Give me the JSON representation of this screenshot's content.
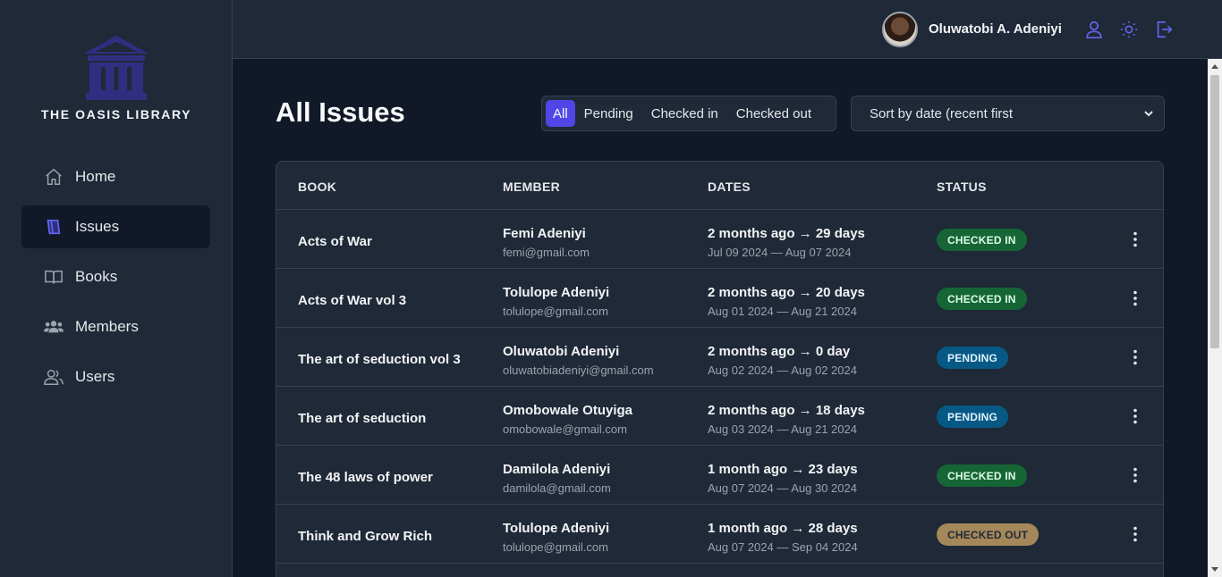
{
  "app": {
    "name": "THE OASIS LIBRARY",
    "accent": "#4f46e5",
    "logo_color": "#312e81"
  },
  "sidebar": {
    "items": [
      {
        "label": "Home",
        "icon": "home-icon",
        "active": false
      },
      {
        "label": "Issues",
        "icon": "book-issues-icon",
        "active": true
      },
      {
        "label": "Books",
        "icon": "open-book-icon",
        "active": false
      },
      {
        "label": "Members",
        "icon": "members-group-icon",
        "active": false
      },
      {
        "label": "Users",
        "icon": "users-icon",
        "active": false
      }
    ]
  },
  "header": {
    "user_name": "Oluwatobi A. Adeniyi",
    "icons": [
      "profile-icon",
      "sun-icon",
      "logout-icon"
    ]
  },
  "main": {
    "title": "All Issues",
    "filters": [
      "All",
      "Pending",
      "Checked in",
      "Checked out"
    ],
    "active_filter": "All",
    "sort": {
      "selected": "Sort by date (recent first"
    },
    "table": {
      "headers": {
        "book": "BOOK",
        "member": "MEMBER",
        "dates": "DATES",
        "status": "STATUS"
      },
      "rows": [
        {
          "book": "Acts of War",
          "member_name": "Femi Adeniyi",
          "member_email": "femi@gmail.com",
          "dates_relative": "2 months ago → 29 days",
          "dates_range": "Jul 09 2024 — Aug 07 2024",
          "status": "CHECKED IN",
          "status_type": "checked-in"
        },
        {
          "book": "Acts of War vol 3",
          "member_name": "Tolulope Adeniyi",
          "member_email": "tolulope@gmail.com",
          "dates_relative": "2 months ago → 20 days",
          "dates_range": "Aug 01 2024 — Aug 21 2024",
          "status": "CHECKED IN",
          "status_type": "checked-in"
        },
        {
          "book": "The art of seduction vol 3",
          "member_name": "Oluwatobi Adeniyi",
          "member_email": "oluwatobiadeniyi@gmail.com",
          "dates_relative": "2 months ago → 0 day",
          "dates_range": "Aug 02 2024 — Aug 02 2024",
          "status": "PENDING",
          "status_type": "pending"
        },
        {
          "book": "The art of seduction",
          "member_name": "Omobowale Otuyiga",
          "member_email": "omobowale@gmail.com",
          "dates_relative": "2 months ago → 18 days",
          "dates_range": "Aug 03 2024 — Aug 21 2024",
          "status": "PENDING",
          "status_type": "pending"
        },
        {
          "book": "The 48 laws of power",
          "member_name": "Damilola Adeniyi",
          "member_email": "damilola@gmail.com",
          "dates_relative": "1 month ago → 23 days",
          "dates_range": "Aug 07 2024 — Aug 30 2024",
          "status": "CHECKED IN",
          "status_type": "checked-in"
        },
        {
          "book": "Think and Grow Rich",
          "member_name": "Tolulope Adeniyi",
          "member_email": "tolulope@gmail.com",
          "dates_relative": "1 month ago → 28 days",
          "dates_range": "Aug 07 2024 — Sep 04 2024",
          "status": "CHECKED OUT",
          "status_type": "checked-out"
        }
      ]
    }
  }
}
